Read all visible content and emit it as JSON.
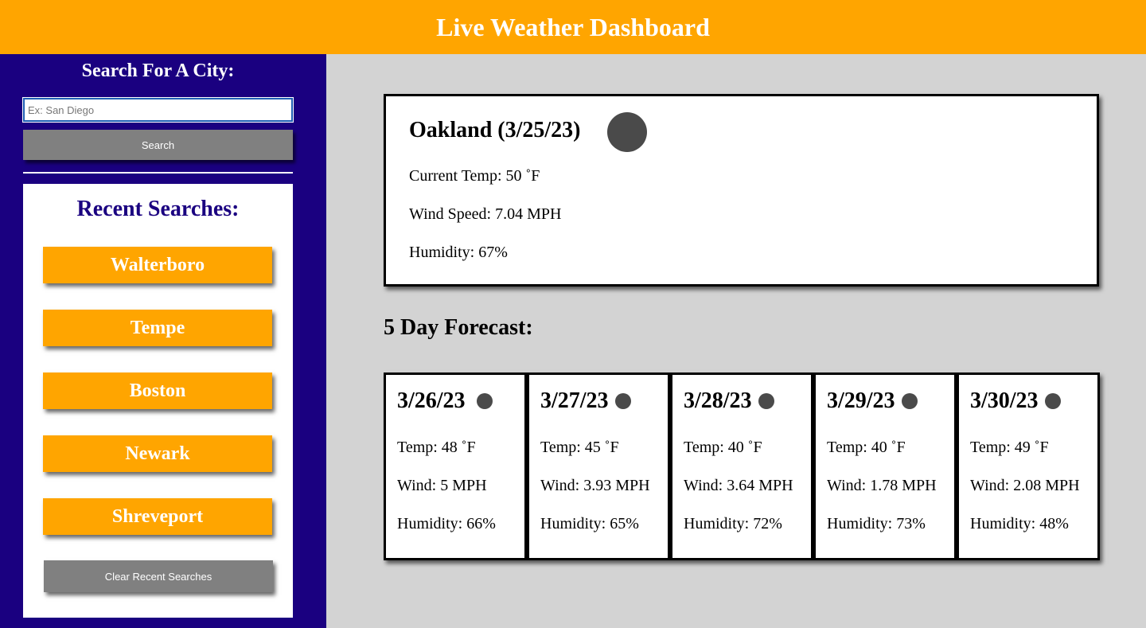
{
  "header": {
    "title": "Live Weather Dashboard"
  },
  "sidebar": {
    "search_heading": "Search For A City:",
    "search_placeholder": "Ex: San Diego",
    "search_value": "",
    "search_button": "Search",
    "recent_heading": "Recent Searches:",
    "recent_cities": [
      "Walterboro",
      "Tempe",
      "Boston",
      "Newark",
      "Shreveport"
    ],
    "clear_button": "Clear Recent Searches"
  },
  "current": {
    "title": "Oakland (3/25/23)",
    "icon": "weather-icon",
    "temp": "Current Temp: 50 ˚F",
    "wind": "Wind Speed: 7.04 MPH",
    "humidity": "Humidity: 67%"
  },
  "forecast": {
    "heading": "5 Day Forecast:",
    "days": [
      {
        "date": "3/26/23",
        "temp": "Temp: 48 ˚F",
        "wind": "Wind: 5 MPH",
        "humidity": "Humidity: 66%"
      },
      {
        "date": "3/27/23",
        "temp": "Temp: 45 ˚F",
        "wind": "Wind: 3.93 MPH",
        "humidity": "Humidity: 65%"
      },
      {
        "date": "3/28/23",
        "temp": "Temp: 40 ˚F",
        "wind": "Wind: 3.64 MPH",
        "humidity": "Humidity: 72%"
      },
      {
        "date": "3/29/23",
        "temp": "Temp: 40 ˚F",
        "wind": "Wind: 1.78 MPH",
        "humidity": "Humidity: 73%"
      },
      {
        "date": "3/30/23",
        "temp": "Temp: 49 ˚F",
        "wind": "Wind: 2.08 MPH",
        "humidity": "Humidity: 48%"
      }
    ]
  },
  "colors": {
    "header_bg": "#ffa500",
    "sidebar_bg": "#1a0080",
    "main_bg": "#d3d3d3",
    "button_gray": "#808080",
    "icon_placeholder": "#4a4a4a"
  }
}
